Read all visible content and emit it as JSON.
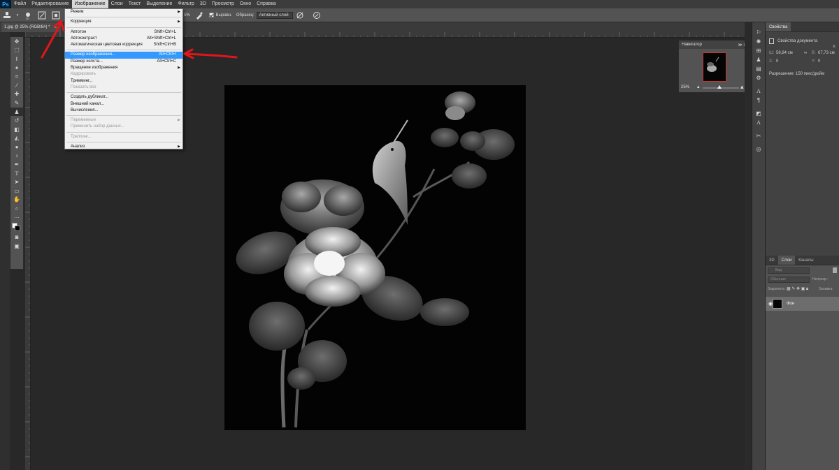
{
  "app": {
    "logo": "Ps"
  },
  "menubar": {
    "items": [
      "Файл",
      "Редактирование",
      "Изображение",
      "Слои",
      "Текст",
      "Выделение",
      "Фильтр",
      "3D",
      "Просмотр",
      "Окно",
      "Справка"
    ]
  },
  "options_bar": {
    "sample_size": "5%",
    "align_label": "Выравн.",
    "sample_label": "Образец:",
    "sample_value": "Активный слой"
  },
  "document": {
    "tab_title": "1.jpg @ 25% (RGB/8#) *",
    "close": "×"
  },
  "image_menu": {
    "items": [
      {
        "label": "Режим",
        "shortcut": "",
        "submenu": true,
        "state": "normal"
      },
      {
        "sep": true
      },
      {
        "label": "Коррекция",
        "shortcut": "",
        "submenu": true,
        "state": "normal"
      },
      {
        "sep": true
      },
      {
        "label": "Автотон",
        "shortcut": "Shift+Ctrl+L",
        "submenu": false,
        "state": "normal"
      },
      {
        "label": "Автоконтраст",
        "shortcut": "Alt+Shift+Ctrl+L",
        "submenu": false,
        "state": "normal"
      },
      {
        "label": "Автоматическая цветовая коррекция",
        "shortcut": "Shift+Ctrl+B",
        "submenu": false,
        "state": "normal"
      },
      {
        "sep": true
      },
      {
        "label": "Размер изображения...",
        "shortcut": "Alt+Ctrl+I",
        "submenu": false,
        "state": "highlight"
      },
      {
        "label": "Размер холста...",
        "shortcut": "Alt+Ctrl+C",
        "submenu": false,
        "state": "normal"
      },
      {
        "label": "Вращение изображения",
        "shortcut": "",
        "submenu": true,
        "state": "normal"
      },
      {
        "label": "Кадрировать",
        "shortcut": "",
        "submenu": false,
        "state": "disabled"
      },
      {
        "label": "Тримминг...",
        "shortcut": "",
        "submenu": false,
        "state": "normal"
      },
      {
        "label": "Показать все",
        "shortcut": "",
        "submenu": false,
        "state": "disabled"
      },
      {
        "sep": true
      },
      {
        "label": "Создать дубликат...",
        "shortcut": "",
        "submenu": false,
        "state": "normal"
      },
      {
        "label": "Внешний канал...",
        "shortcut": "",
        "submenu": false,
        "state": "normal"
      },
      {
        "label": "Вычисления...",
        "shortcut": "",
        "submenu": false,
        "state": "normal"
      },
      {
        "sep": true
      },
      {
        "label": "Переменные",
        "shortcut": "",
        "submenu": true,
        "state": "disabled"
      },
      {
        "label": "Применить набор данных...",
        "shortcut": "",
        "submenu": false,
        "state": "disabled"
      },
      {
        "sep": true
      },
      {
        "label": "Треппинг...",
        "shortcut": "",
        "submenu": false,
        "state": "disabled"
      },
      {
        "sep": true
      },
      {
        "label": "Анализ",
        "shortcut": "",
        "submenu": true,
        "state": "normal"
      }
    ]
  },
  "navigator": {
    "title": "Навигатор",
    "zoom": "25%",
    "zoom_level": 0.25
  },
  "properties": {
    "tab": "Свойства",
    "title": "Свойства документа",
    "width_label": "Ш:",
    "width_value": "58,84 см",
    "height_label": "В:",
    "height_value": "67,73 см",
    "x_label": "X:",
    "x_value": "0",
    "y_label": "Y:",
    "y_value": "0",
    "resolution": "Разрешение: 150 пикс/дюйм"
  },
  "layers": {
    "tabs": [
      "3D",
      "Слои",
      "Каналы"
    ],
    "active_tab": "Слои",
    "search_placeholder": "Вид",
    "blend_mode": "Обычные",
    "opacity_label": "Непрозр.:",
    "lock_label": "Закрепить:",
    "fill_label": "Заливка:",
    "layer_name": "Фон"
  },
  "colors": {
    "highlight": "#3399ff",
    "annotation_arrow": "#e0161b",
    "foreground": "#ffffff",
    "background": "#000000"
  }
}
